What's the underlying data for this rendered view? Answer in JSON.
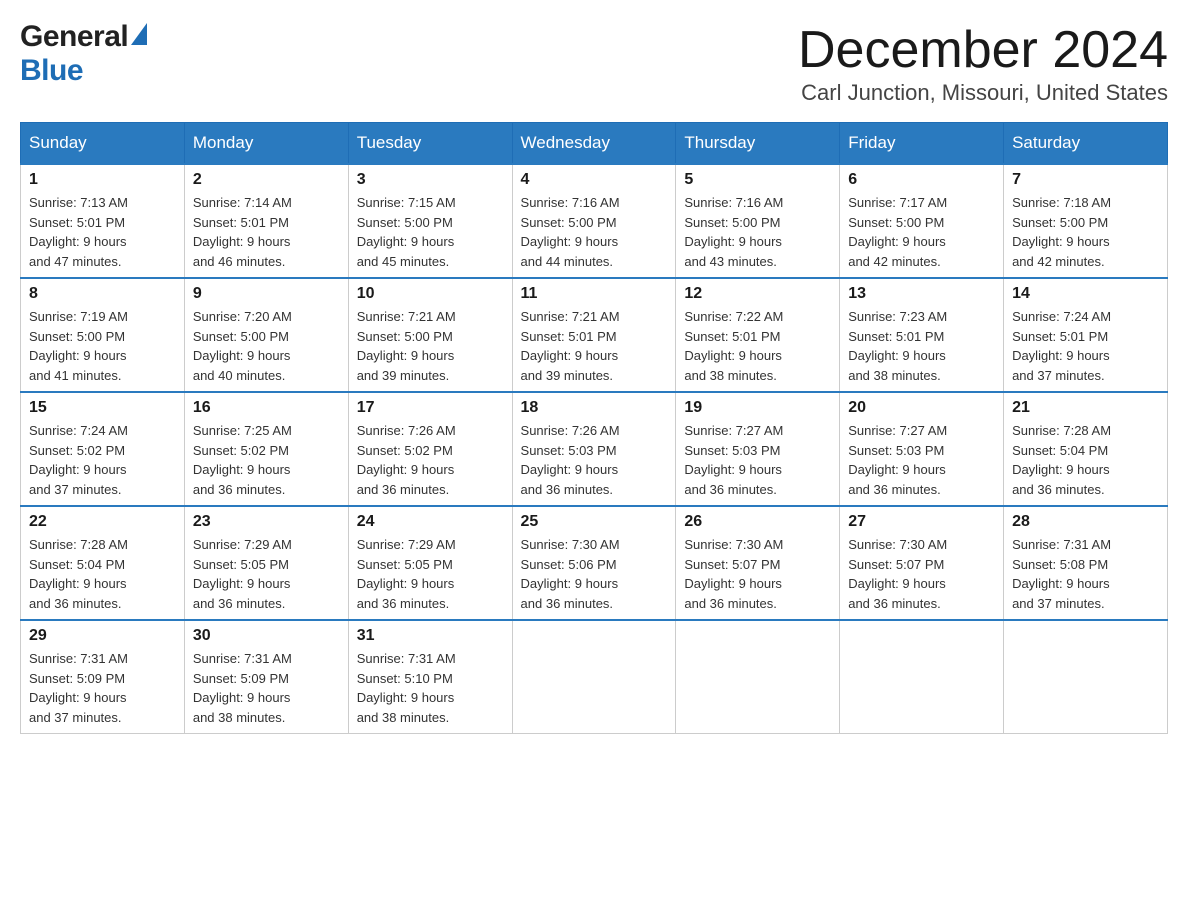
{
  "header": {
    "month_title": "December 2024",
    "location": "Carl Junction, Missouri, United States",
    "logo_general": "General",
    "logo_blue": "Blue"
  },
  "days_of_week": [
    "Sunday",
    "Monday",
    "Tuesday",
    "Wednesday",
    "Thursday",
    "Friday",
    "Saturday"
  ],
  "weeks": [
    [
      {
        "day": "1",
        "sunrise": "Sunrise: 7:13 AM",
        "sunset": "Sunset: 5:01 PM",
        "daylight": "Daylight: 9 hours",
        "daylight2": "and 47 minutes."
      },
      {
        "day": "2",
        "sunrise": "Sunrise: 7:14 AM",
        "sunset": "Sunset: 5:01 PM",
        "daylight": "Daylight: 9 hours",
        "daylight2": "and 46 minutes."
      },
      {
        "day": "3",
        "sunrise": "Sunrise: 7:15 AM",
        "sunset": "Sunset: 5:00 PM",
        "daylight": "Daylight: 9 hours",
        "daylight2": "and 45 minutes."
      },
      {
        "day": "4",
        "sunrise": "Sunrise: 7:16 AM",
        "sunset": "Sunset: 5:00 PM",
        "daylight": "Daylight: 9 hours",
        "daylight2": "and 44 minutes."
      },
      {
        "day": "5",
        "sunrise": "Sunrise: 7:16 AM",
        "sunset": "Sunset: 5:00 PM",
        "daylight": "Daylight: 9 hours",
        "daylight2": "and 43 minutes."
      },
      {
        "day": "6",
        "sunrise": "Sunrise: 7:17 AM",
        "sunset": "Sunset: 5:00 PM",
        "daylight": "Daylight: 9 hours",
        "daylight2": "and 42 minutes."
      },
      {
        "day": "7",
        "sunrise": "Sunrise: 7:18 AM",
        "sunset": "Sunset: 5:00 PM",
        "daylight": "Daylight: 9 hours",
        "daylight2": "and 42 minutes."
      }
    ],
    [
      {
        "day": "8",
        "sunrise": "Sunrise: 7:19 AM",
        "sunset": "Sunset: 5:00 PM",
        "daylight": "Daylight: 9 hours",
        "daylight2": "and 41 minutes."
      },
      {
        "day": "9",
        "sunrise": "Sunrise: 7:20 AM",
        "sunset": "Sunset: 5:00 PM",
        "daylight": "Daylight: 9 hours",
        "daylight2": "and 40 minutes."
      },
      {
        "day": "10",
        "sunrise": "Sunrise: 7:21 AM",
        "sunset": "Sunset: 5:00 PM",
        "daylight": "Daylight: 9 hours",
        "daylight2": "and 39 minutes."
      },
      {
        "day": "11",
        "sunrise": "Sunrise: 7:21 AM",
        "sunset": "Sunset: 5:01 PM",
        "daylight": "Daylight: 9 hours",
        "daylight2": "and 39 minutes."
      },
      {
        "day": "12",
        "sunrise": "Sunrise: 7:22 AM",
        "sunset": "Sunset: 5:01 PM",
        "daylight": "Daylight: 9 hours",
        "daylight2": "and 38 minutes."
      },
      {
        "day": "13",
        "sunrise": "Sunrise: 7:23 AM",
        "sunset": "Sunset: 5:01 PM",
        "daylight": "Daylight: 9 hours",
        "daylight2": "and 38 minutes."
      },
      {
        "day": "14",
        "sunrise": "Sunrise: 7:24 AM",
        "sunset": "Sunset: 5:01 PM",
        "daylight": "Daylight: 9 hours",
        "daylight2": "and 37 minutes."
      }
    ],
    [
      {
        "day": "15",
        "sunrise": "Sunrise: 7:24 AM",
        "sunset": "Sunset: 5:02 PM",
        "daylight": "Daylight: 9 hours",
        "daylight2": "and 37 minutes."
      },
      {
        "day": "16",
        "sunrise": "Sunrise: 7:25 AM",
        "sunset": "Sunset: 5:02 PM",
        "daylight": "Daylight: 9 hours",
        "daylight2": "and 36 minutes."
      },
      {
        "day": "17",
        "sunrise": "Sunrise: 7:26 AM",
        "sunset": "Sunset: 5:02 PM",
        "daylight": "Daylight: 9 hours",
        "daylight2": "and 36 minutes."
      },
      {
        "day": "18",
        "sunrise": "Sunrise: 7:26 AM",
        "sunset": "Sunset: 5:03 PM",
        "daylight": "Daylight: 9 hours",
        "daylight2": "and 36 minutes."
      },
      {
        "day": "19",
        "sunrise": "Sunrise: 7:27 AM",
        "sunset": "Sunset: 5:03 PM",
        "daylight": "Daylight: 9 hours",
        "daylight2": "and 36 minutes."
      },
      {
        "day": "20",
        "sunrise": "Sunrise: 7:27 AM",
        "sunset": "Sunset: 5:03 PM",
        "daylight": "Daylight: 9 hours",
        "daylight2": "and 36 minutes."
      },
      {
        "day": "21",
        "sunrise": "Sunrise: 7:28 AM",
        "sunset": "Sunset: 5:04 PM",
        "daylight": "Daylight: 9 hours",
        "daylight2": "and 36 minutes."
      }
    ],
    [
      {
        "day": "22",
        "sunrise": "Sunrise: 7:28 AM",
        "sunset": "Sunset: 5:04 PM",
        "daylight": "Daylight: 9 hours",
        "daylight2": "and 36 minutes."
      },
      {
        "day": "23",
        "sunrise": "Sunrise: 7:29 AM",
        "sunset": "Sunset: 5:05 PM",
        "daylight": "Daylight: 9 hours",
        "daylight2": "and 36 minutes."
      },
      {
        "day": "24",
        "sunrise": "Sunrise: 7:29 AM",
        "sunset": "Sunset: 5:05 PM",
        "daylight": "Daylight: 9 hours",
        "daylight2": "and 36 minutes."
      },
      {
        "day": "25",
        "sunrise": "Sunrise: 7:30 AM",
        "sunset": "Sunset: 5:06 PM",
        "daylight": "Daylight: 9 hours",
        "daylight2": "and 36 minutes."
      },
      {
        "day": "26",
        "sunrise": "Sunrise: 7:30 AM",
        "sunset": "Sunset: 5:07 PM",
        "daylight": "Daylight: 9 hours",
        "daylight2": "and 36 minutes."
      },
      {
        "day": "27",
        "sunrise": "Sunrise: 7:30 AM",
        "sunset": "Sunset: 5:07 PM",
        "daylight": "Daylight: 9 hours",
        "daylight2": "and 36 minutes."
      },
      {
        "day": "28",
        "sunrise": "Sunrise: 7:31 AM",
        "sunset": "Sunset: 5:08 PM",
        "daylight": "Daylight: 9 hours",
        "daylight2": "and 37 minutes."
      }
    ],
    [
      {
        "day": "29",
        "sunrise": "Sunrise: 7:31 AM",
        "sunset": "Sunset: 5:09 PM",
        "daylight": "Daylight: 9 hours",
        "daylight2": "and 37 minutes."
      },
      {
        "day": "30",
        "sunrise": "Sunrise: 7:31 AM",
        "sunset": "Sunset: 5:09 PM",
        "daylight": "Daylight: 9 hours",
        "daylight2": "and 38 minutes."
      },
      {
        "day": "31",
        "sunrise": "Sunrise: 7:31 AM",
        "sunset": "Sunset: 5:10 PM",
        "daylight": "Daylight: 9 hours",
        "daylight2": "and 38 minutes."
      },
      {
        "day": "",
        "sunrise": "",
        "sunset": "",
        "daylight": "",
        "daylight2": ""
      },
      {
        "day": "",
        "sunrise": "",
        "sunset": "",
        "daylight": "",
        "daylight2": ""
      },
      {
        "day": "",
        "sunrise": "",
        "sunset": "",
        "daylight": "",
        "daylight2": ""
      },
      {
        "day": "",
        "sunrise": "",
        "sunset": "",
        "daylight": "",
        "daylight2": ""
      }
    ]
  ]
}
